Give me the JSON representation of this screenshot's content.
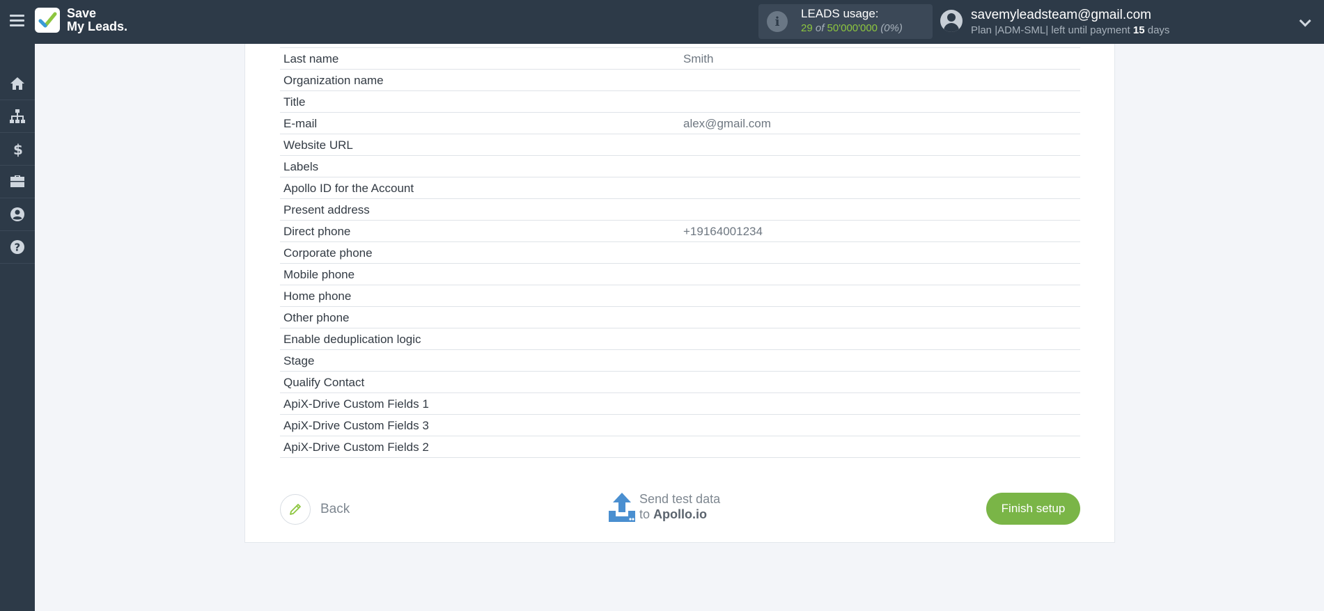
{
  "header": {
    "logo_line1": "Save",
    "logo_line2": "My Leads.",
    "usage_title": "LEADS usage:",
    "usage_used": "29",
    "usage_of": "of",
    "usage_limit": "50'000'000",
    "usage_percent": "(0%)",
    "user_email": "savemyleadsteam@gmail.com",
    "plan_prefix": "Plan |ADM-SML| left until payment",
    "plan_days": "15",
    "plan_suffix": "days"
  },
  "sidebar": {
    "items": [
      {
        "icon": "home-icon"
      },
      {
        "icon": "sitemap-icon"
      },
      {
        "icon": "dollar-icon"
      },
      {
        "icon": "briefcase-icon"
      },
      {
        "icon": "user-icon"
      },
      {
        "icon": "help-icon"
      }
    ]
  },
  "fields": [
    {
      "label": "Last name",
      "value": "Smith"
    },
    {
      "label": "Organization name",
      "value": ""
    },
    {
      "label": "Title",
      "value": ""
    },
    {
      "label": "E-mail",
      "value": "alex@gmail.com"
    },
    {
      "label": "Website URL",
      "value": ""
    },
    {
      "label": "Labels",
      "value": ""
    },
    {
      "label": "Apollo ID for the Account",
      "value": ""
    },
    {
      "label": "Present address",
      "value": ""
    },
    {
      "label": "Direct phone",
      "value": "+19164001234"
    },
    {
      "label": "Corporate phone",
      "value": ""
    },
    {
      "label": "Mobile phone",
      "value": ""
    },
    {
      "label": "Home phone",
      "value": ""
    },
    {
      "label": "Other phone",
      "value": ""
    },
    {
      "label": "Enable deduplication logic",
      "value": ""
    },
    {
      "label": "Stage",
      "value": ""
    },
    {
      "label": "Qualify Contact",
      "value": ""
    },
    {
      "label": "ApiX-Drive Custom Fields 1",
      "value": ""
    },
    {
      "label": "ApiX-Drive Custom Fields 3",
      "value": ""
    },
    {
      "label": "ApiX-Drive Custom Fields 2",
      "value": ""
    }
  ],
  "actions": {
    "back_label": "Back",
    "send_line1": "Send test data",
    "send_to": "to",
    "send_service": "Apollo.io",
    "finish_label": "Finish setup"
  },
  "colors": {
    "topbar": "#2d3a48",
    "accent_green": "#7ab547",
    "usage_green": "#8dc63f",
    "upload_blue": "#4a8fd0"
  }
}
